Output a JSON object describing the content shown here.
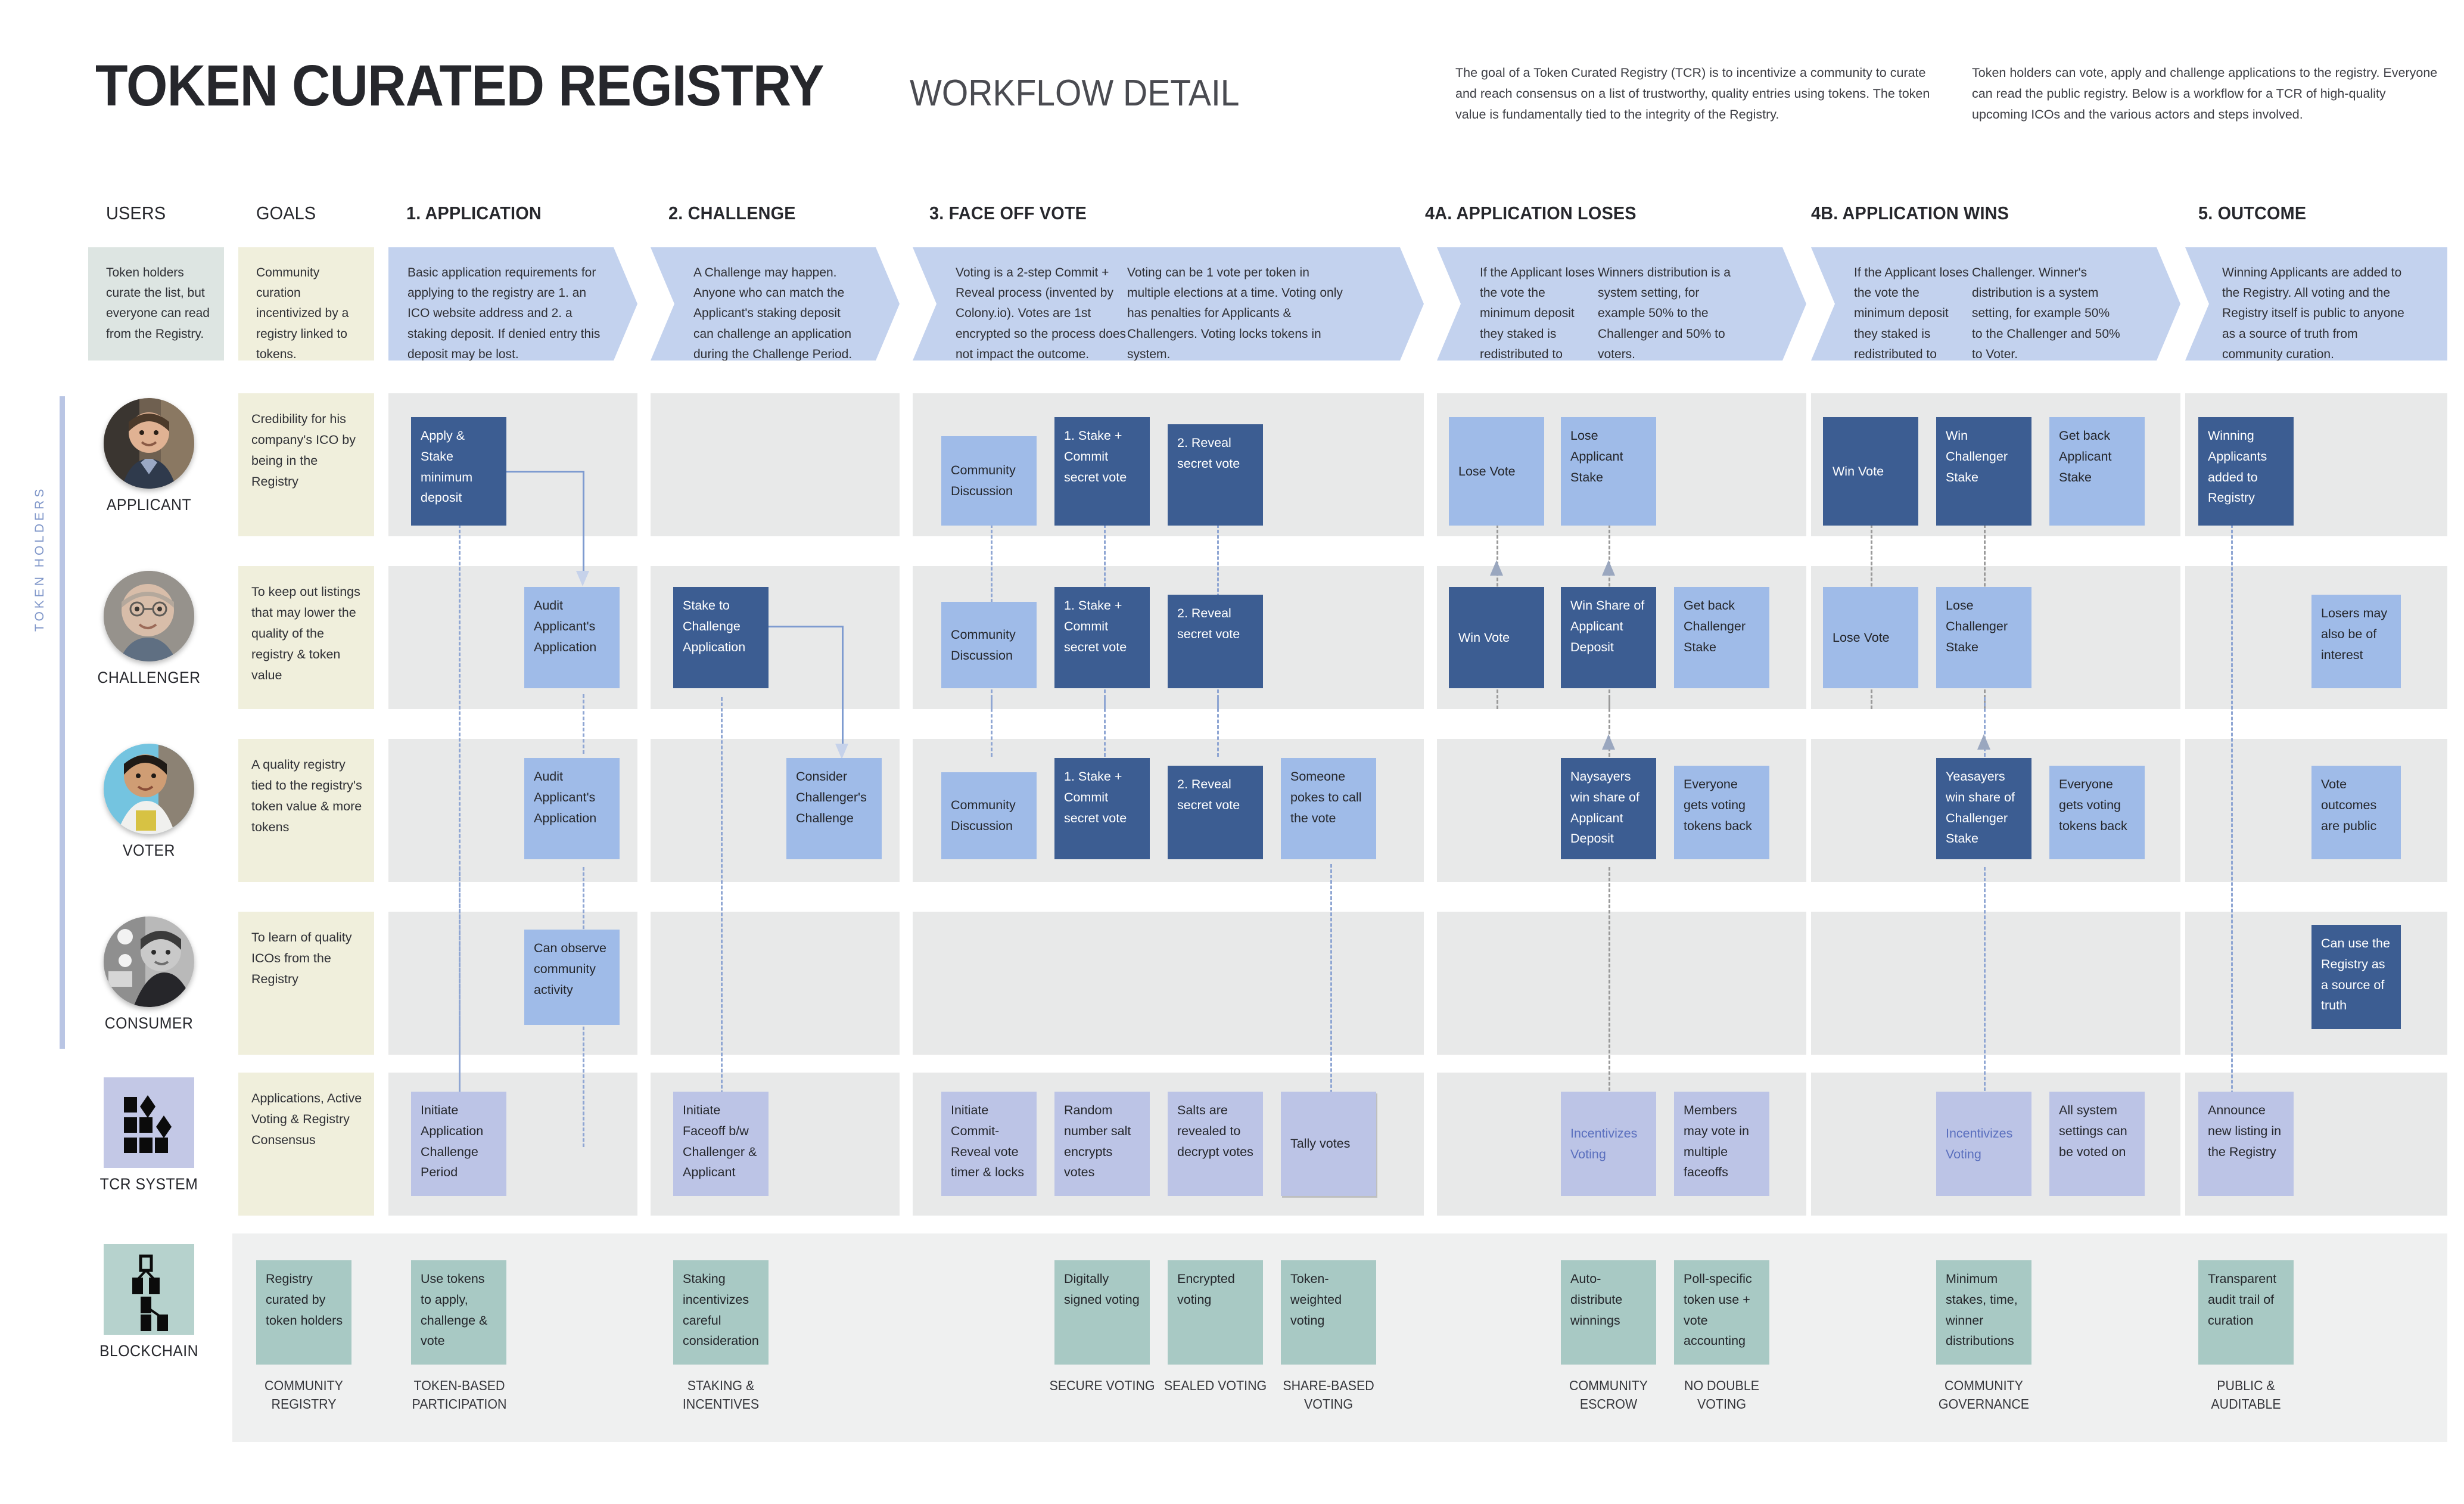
{
  "header": {
    "title": "TOKEN CURATED REGISTRY",
    "subtitle": "WORKFLOW DETAIL",
    "blurb_left": "The goal of a Token Curated Registry (TCR) is to incentivize a community to curate and reach consensus on a list of trustworthy, quality entries using tokens. The token value is fundamentally tied to the integrity of the Registry.",
    "blurb_right": "Token holders can vote, apply and challenge applications to the registry. Everyone can read the public registry. Below is a workflow for a TCR of high-quality upcoming ICOs and the various actors and steps involved."
  },
  "columns": {
    "users": "USERS",
    "goals": "GOALS",
    "application": "1. APPLICATION",
    "challenge": "2. CHALLENGE",
    "faceoff": "3. FACE OFF VOTE",
    "loses": "4A. APPLICATION LOSES",
    "wins": "4B. APPLICATION WINS",
    "outcome": "5. OUTCOME"
  },
  "descriptions": {
    "users": "Token holders curate the list, but everyone can read from the Registry.",
    "goals": "Community curation incentivized by a registry linked to tokens.",
    "application": "Basic application requirements for applying to the registry are 1. an ICO website address and 2. a staking deposit. If denied entry this deposit may be lost.",
    "challenge": "A Challenge may happen. Anyone who can match the Applicant's staking deposit can challenge an application during the Challenge Period.",
    "faceoff_a": "Voting is a 2-step Commit + Reveal process (invented by Colony.io). Votes are 1st encrypted so the process does not impact the outcome.",
    "faceoff_b": "Voting can be 1 vote per token in multiple elections at a time. Voting only has penalties for Applicants & Challengers. Voting locks tokens in system.",
    "loses_a": "If the Applicant loses the vote the minimum deposit they staked is redistributed to winning voters and Challenger.",
    "loses_b": "Winners distribution is a system setting, for example 50% to the Challenger and 50% to voters.",
    "wins_a": "If the Applicant loses the vote the minimum deposit they staked is redistributed to winning voters and",
    "wins_b": "Challenger. Winner's distribution is a system setting, for example 50% to the Challenger and 50% to Voter.",
    "outcome": "Winning Applicants are added to the Registry. All voting and the Registry itself is public to anyone as a source of truth from community curation."
  },
  "rail_label": "TOKEN  HOLDERS",
  "personas": {
    "applicant": "APPLICANT",
    "challenger": "CHALLENGER",
    "voter": "VOTER",
    "consumer": "CONSUMER",
    "tcr_system": "TCR SYSTEM",
    "blockchain": "BLOCKCHAIN"
  },
  "goals_text": {
    "applicant": "Credibility for his company's ICO by being in the Registry",
    "challenger": "To keep out listings that may lower the quality of the registry & token value",
    "voter": "A quality registry tied to the registry's token value & more tokens",
    "consumer": "To learn of quality ICOs from the Registry",
    "tcr_system": "Applications, Active Voting & Registry Consensus"
  },
  "nodes": {
    "applicant": {
      "apply_stake": "Apply & Stake minimum deposit",
      "community_discussion": "Community Discussion",
      "commit": "1. Stake + Commit secret vote",
      "reveal": "2. Reveal secret vote",
      "lose_vote": "Lose Vote",
      "lose_applicant_stake": "Lose Applicant Stake",
      "win_vote": "Win Vote",
      "win_challenger_stake": "Win Challenger Stake",
      "get_back_applicant_stake": "Get back Applicant Stake",
      "winning_added": "Winning Applicants added to Registry"
    },
    "challenger": {
      "audit": "Audit Applicant's Application",
      "stake_to_challenge": "Stake to Challenge Application",
      "community_discussion": "Community Discussion",
      "commit": "1. Stake + Commit secret vote",
      "reveal": "2. Reveal secret vote",
      "win_vote": "Win Vote",
      "win_share_applicant_deposit": "Win Share of Applicant Deposit",
      "get_back_challenger_stake": "Get back Challenger Stake",
      "lose_vote": "Lose Vote",
      "lose_challenger_stake": "Lose Challenger Stake",
      "losers_interest": "Losers may also be of interest"
    },
    "voter": {
      "audit": "Audit Applicant's Application",
      "consider": "Consider Challenger's Challenge",
      "community_discussion": "Community Discussion",
      "commit": "1. Stake + Commit secret vote",
      "reveal": "2. Reveal secret vote",
      "poke": "Someone pokes to call the vote",
      "naysayers": "Naysayers win share of Applicant Deposit",
      "everyone_back_a": "Everyone gets voting tokens back",
      "yeasayers": "Yeasayers win share of Challenger Stake",
      "everyone_back_b": "Everyone gets voting tokens back",
      "outcomes_public": "Vote outcomes are public"
    },
    "consumer": {
      "observe": "Can observe community activity",
      "source_of_truth": "Can use the Registry as a source of truth"
    },
    "tcr_system": {
      "initiate_app_challenge": "Initiate Application Challenge Period",
      "initiate_faceoff": "Initiate Faceoff b/w Challenger & Applicant",
      "initiate_commit_reveal": "Initiate Commit-Reveal vote timer & locks",
      "random_salt": "Random number salt encrypts votes",
      "salts_revealed": "Salts are revealed to decrypt votes",
      "tally": "Tally votes",
      "incentivizes_a": "Incentivizes Voting",
      "members_multiple": "Members may vote in multiple faceoffs",
      "incentivizes_b": "Incentivizes Voting",
      "all_settings": "All system settings can be voted on",
      "announce": "Announce new listing in the Registry"
    },
    "blockchain": [
      {
        "text": "Registry curated by token holders",
        "caption": "COMMUNITY REGISTRY"
      },
      {
        "text": "Use tokens to apply, challenge & vote",
        "caption": "TOKEN-BASED PARTICIPATION"
      },
      {
        "text": "Staking incentivizes careful consideration",
        "caption": "STAKING & INCENTIVES"
      },
      {
        "text": "Digitally signed voting",
        "caption": "SECURE VOTING"
      },
      {
        "text": "Encrypted voting",
        "caption": "SEALED VOTING"
      },
      {
        "text": "Token-weighted voting",
        "caption": "SHARE-BASED VOTING"
      },
      {
        "text": "Auto-distribute winnings",
        "caption": "COMMUNITY ESCROW"
      },
      {
        "text": "Poll-specific token use + vote accounting",
        "caption": "NO DOUBLE VOTING"
      },
      {
        "text": "Minimum stakes, time, winner distributions",
        "caption": "COMMUNITY GOVERNANCE"
      },
      {
        "text": "Transparent audit trail of curation",
        "caption": "PUBLIC & AUDITABLE"
      }
    ]
  },
  "colors": {
    "dark_blue": "#3c5d92",
    "mid_blue": "#9fbbe8",
    "band_gray": "#e8e9e9",
    "goal_cream": "#f0efdc",
    "users_sage": "#dde5e2",
    "chevron_blue": "#c3d2ee",
    "system_lilac": "#bcc4e6",
    "blockchain_teal": "#a8c9c4"
  }
}
